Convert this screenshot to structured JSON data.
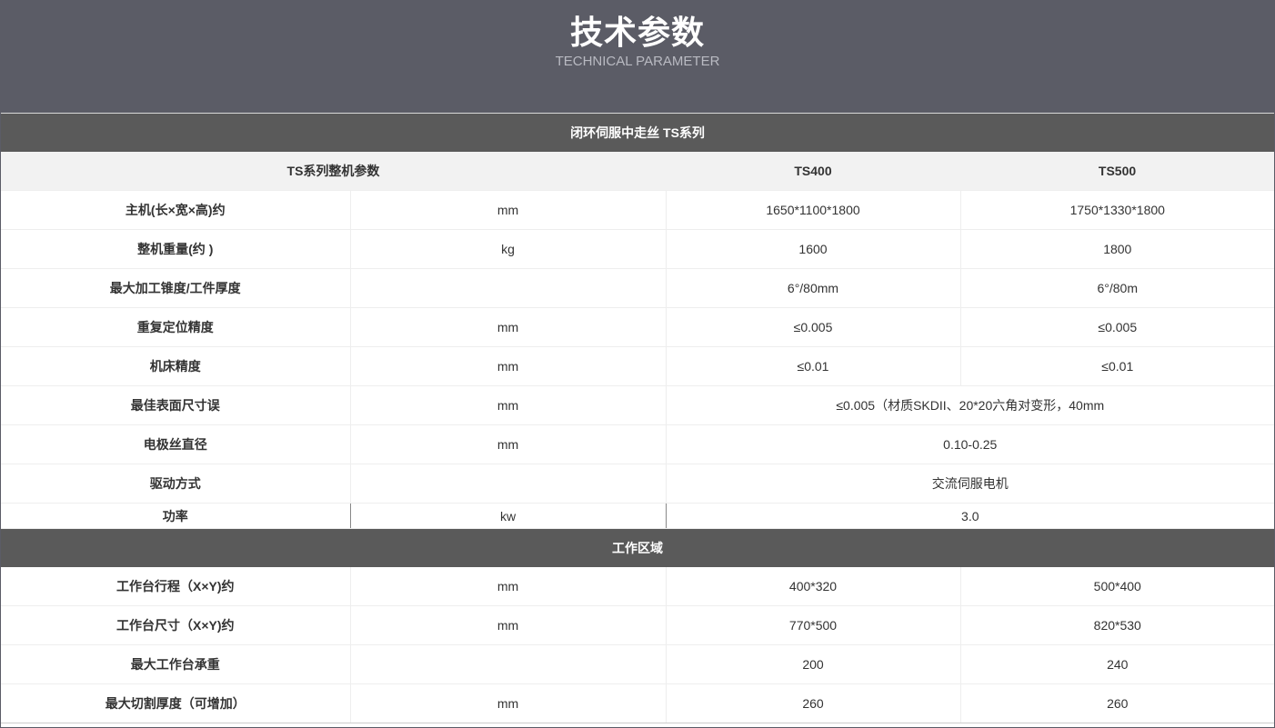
{
  "header": {
    "title": "技术参数",
    "subtitle": "TECHNICAL PARAMETER"
  },
  "section1": {
    "title": "闭环伺服中走丝  TS系列",
    "subhead": {
      "label": "TS系列整机参数",
      "col_a": "TS400",
      "col_b": "TS500"
    },
    "rows": [
      {
        "label": "主机(长×宽×高)约",
        "unit": "mm",
        "a": "1650*1100*1800",
        "b": "1750*1330*1800"
      },
      {
        "label": "整机重量(约 )",
        "unit": "kg",
        "a": "1600",
        "b": "1800"
      },
      {
        "label": "最大加工锥度/工件厚度",
        "unit": "",
        "a": "6°/80mm",
        "b": "6°/80m"
      },
      {
        "label": "重复定位精度",
        "unit": "mm",
        "a": "≤0.005",
        "b": "≤0.005"
      },
      {
        "label": "机床精度",
        "unit": "mm",
        "a": "≤0.01",
        "b": "≤0.01"
      }
    ],
    "merged_rows": [
      {
        "label": "最佳表面尺寸误",
        "unit": "mm",
        "value": "≤0.005（材质SKDII、20*20六角对变形，40mm"
      },
      {
        "label": "电极丝直径",
        "unit": "mm",
        "value": "0.10-0.25"
      },
      {
        "label": "驱动方式",
        "unit": "",
        "value": "交流伺服电机"
      },
      {
        "label": "功率",
        "unit": "kw",
        "value": "3.0"
      }
    ]
  },
  "section2": {
    "title": "工作区域",
    "rows": [
      {
        "label": "工作台行程（X×Y)约",
        "unit": "mm",
        "a": "400*320",
        "b": "500*400"
      },
      {
        "label": "工作台尺寸（X×Y)约",
        "unit": "mm",
        "a": "770*500",
        "b": "820*530"
      },
      {
        "label": "最大工作台承重",
        "unit": "",
        "a": "200",
        "b": "240"
      },
      {
        "label": "最大切割厚度（可增加）",
        "unit": "mm",
        "a": "260",
        "b": "260"
      }
    ]
  }
}
